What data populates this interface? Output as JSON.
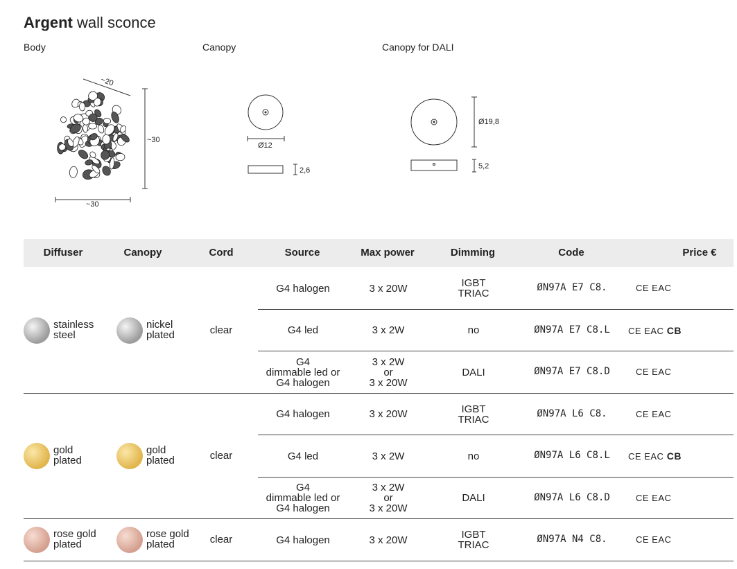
{
  "title": {
    "bold": "Argent",
    "rest": "wall sconce"
  },
  "sections": {
    "body": "Body",
    "canopy": "Canopy",
    "canopy_dali": "Canopy for DALI"
  },
  "dims": {
    "body_depth": "~20",
    "body_height": "~30",
    "body_width": "~30",
    "canopy_dia": "Ø12",
    "canopy_h": "2,6",
    "dali_dia": "Ø19,8",
    "dali_h": "5,2"
  },
  "headers": {
    "diffuser": "Diffuser",
    "canopy": "Canopy",
    "cord": "Cord",
    "source": "Source",
    "max_power": "Max power",
    "dimming": "Dimming",
    "code": "Code",
    "price": "Price €"
  },
  "groups": [
    {
      "diffuser": [
        "stainless",
        "steel"
      ],
      "canopy": [
        "nickel",
        "plated"
      ],
      "cord": "clear",
      "rows": [
        {
          "source": [
            "G4 halogen"
          ],
          "power": [
            "3 x 20W"
          ],
          "dimming": [
            "IGBT",
            "TRIAC"
          ],
          "code": "ØN97A E7 C8.",
          "cert": "CE EAC",
          "cb": ""
        },
        {
          "source": [
            "G4 led"
          ],
          "power": [
            "3 x 2W"
          ],
          "dimming": [
            "no"
          ],
          "code": "ØN97A  E7 C8.L",
          "cert": "CE EAC",
          "cb": "CB"
        },
        {
          "source": [
            "G4",
            "dimmable led or",
            "G4 halogen"
          ],
          "power": [
            "3 x 2W",
            "or",
            "3 x 20W"
          ],
          "dimming": [
            "DALI"
          ],
          "code": "ØN97A E7 C8.D",
          "cert": "CE EAC",
          "cb": ""
        }
      ]
    },
    {
      "diffuser": [
        "gold",
        "plated"
      ],
      "canopy": [
        "gold",
        "plated"
      ],
      "cord": "clear",
      "rows": [
        {
          "source": [
            "G4 halogen"
          ],
          "power": [
            "3 x 20W"
          ],
          "dimming": [
            "IGBT",
            "TRIAC"
          ],
          "code": "ØN97A L6 C8.",
          "cert": "CE EAC",
          "cb": ""
        },
        {
          "source": [
            "G4 led"
          ],
          "power": [
            "3 x 2W"
          ],
          "dimming": [
            "no"
          ],
          "code": "ØN97A L6 C8.L",
          "cert": "CE EAC",
          "cb": "CB"
        },
        {
          "source": [
            "G4",
            "dimmable led or",
            "G4 halogen"
          ],
          "power": [
            "3 x 2W",
            "or",
            "3 x 20W"
          ],
          "dimming": [
            "DALI"
          ],
          "code": "ØN97A L6 C8.D",
          "cert": "CE EAC",
          "cb": ""
        }
      ]
    },
    {
      "diffuser": [
        "rose gold",
        "plated"
      ],
      "canopy": [
        "rose gold",
        "plated"
      ],
      "cord": "clear",
      "rows": [
        {
          "source": [
            "G4 halogen"
          ],
          "power": [
            "3 x 20W"
          ],
          "dimming": [
            "IGBT",
            "TRIAC"
          ],
          "code": "ØN97A N4 C8.",
          "cert": "CE EAC",
          "cb": ""
        }
      ]
    }
  ]
}
